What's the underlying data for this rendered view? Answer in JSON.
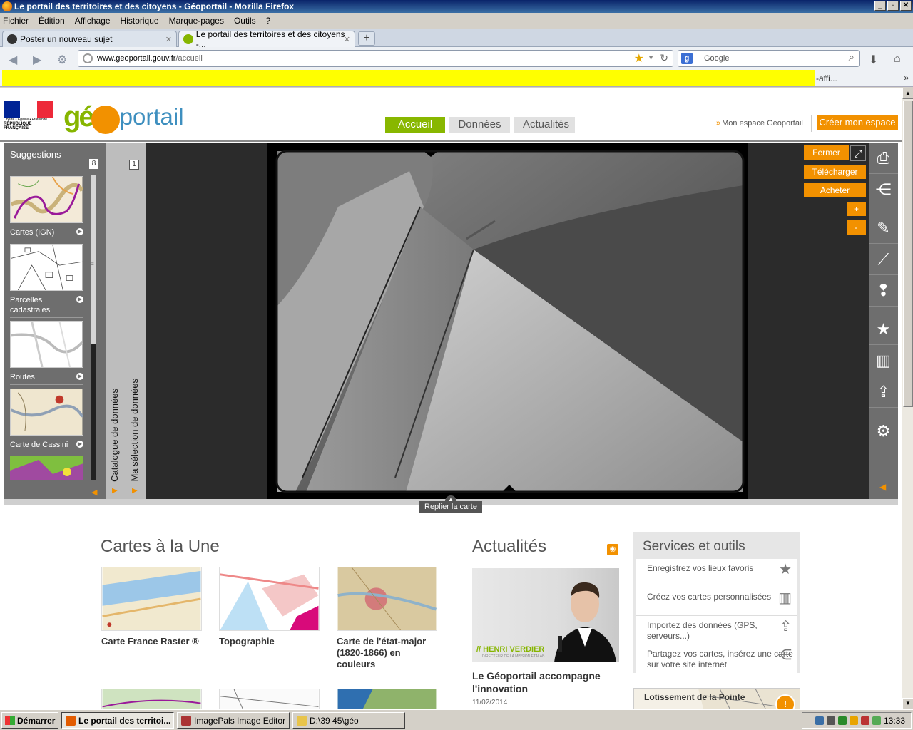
{
  "window": {
    "title": "Le portail des territoires et des citoyens - Géoportail - Mozilla Firefox",
    "controls": [
      "_",
      "▫",
      "✕"
    ]
  },
  "menu": [
    "Fichier",
    "Édition",
    "Affichage",
    "Historique",
    "Marque-pages",
    "Outils",
    "?"
  ],
  "tabs": [
    {
      "label": "Poster un nouveau sujet",
      "active": false
    },
    {
      "label": "Le portail des territoires et des citoyens -...",
      "active": true
    }
  ],
  "newtab_label": "+",
  "url": {
    "host": "www.geoportail.gouv.fr",
    "path": "/accueil"
  },
  "search": {
    "placeholder": "Google"
  },
  "bookmarks": {
    "text": "-affi...",
    "more": "»"
  },
  "site": {
    "logo_rf": {
      "motto": "Liberté • Égalité • Fraternité",
      "name": "RÉPUBLIQUE FRANÇAISE"
    },
    "logo": {
      "geo": "gé",
      "portail": "portail"
    },
    "nav": [
      "Accueil",
      "Données",
      "Actualités"
    ],
    "mon_espace": "Mon espace Géoportail",
    "creer": "Créer mon espace"
  },
  "suggestions": {
    "title": "Suggestions",
    "count": "8",
    "items": [
      {
        "label": "Cartes (IGN)"
      },
      {
        "label": "Parcelles cadastrales"
      },
      {
        "label": "Routes"
      },
      {
        "label": "Carte de Cassini"
      }
    ]
  },
  "vtabs": {
    "catalogue": "Catalogue de données",
    "selection": "Ma sélection de données",
    "selection_count": "1"
  },
  "photo_controls": {
    "fermer": "Fermer",
    "telecharger": "Télécharger",
    "acheter": "Acheter",
    "plus": "+",
    "minus": "-"
  },
  "tools": [
    "print-icon",
    "share-icon",
    "pencil-icon",
    "ruler-icon",
    "alert-icon",
    "star-icon",
    "map-icon",
    "import-icon",
    "gear-icon"
  ],
  "replier": "Replier la carte",
  "cartes": {
    "title": "Cartes à la Une",
    "items": [
      {
        "caption": "Carte France Raster ®"
      },
      {
        "caption": "Topographie"
      },
      {
        "caption": "Carte de l'état-major (1820-1866) en couleurs"
      }
    ]
  },
  "actualites": {
    "title": "Actualités",
    "image_name": "// HENRI VERDIER",
    "image_role": "DIRECTEUR DE LA MISSION ETALAB",
    "headline": "Le Géoportail accompagne l'innovation",
    "date": "11/02/2014"
  },
  "services": {
    "title": "Services et outils",
    "items": [
      {
        "label": "Enregistrez vos lieux favoris",
        "icon": "star-icon"
      },
      {
        "label": "Créez vos cartes personnalisées",
        "icon": "map-icon"
      },
      {
        "label": "Importez des données (GPS, serveurs...)",
        "icon": "import-icon"
      },
      {
        "label": "Partagez vos cartes, insérez une carte sur votre site internet",
        "icon": "share-icon"
      }
    ]
  },
  "promo": {
    "title": "Lotissement de la Pointe"
  },
  "taskbar": {
    "start": "Démarrer",
    "items": [
      {
        "label": "Le portail des territoi..."
      },
      {
        "label": "ImagePals Image Editor"
      },
      {
        "label": "D:\\39 45\\géo"
      }
    ],
    "clock": "13:33"
  }
}
